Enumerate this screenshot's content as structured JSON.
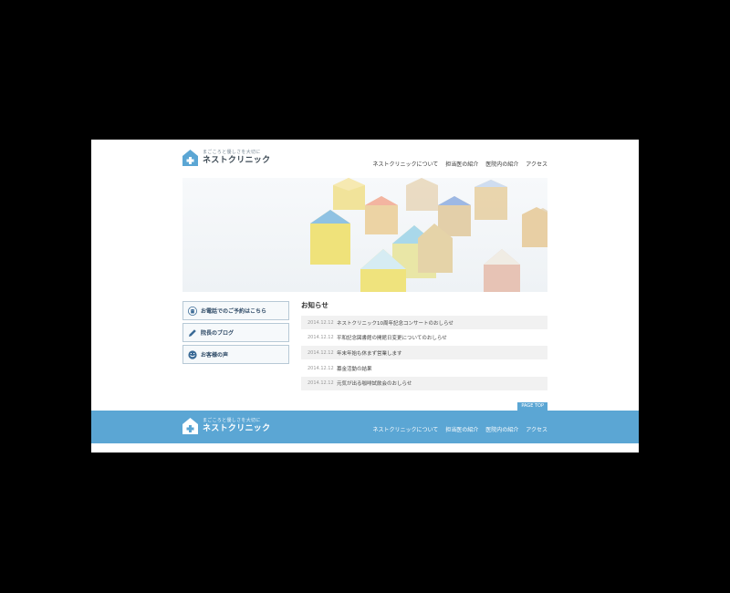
{
  "header": {
    "tagline": "まごころと優しさを大切に",
    "brand": "ネストクリニック",
    "nav": [
      "ネストクリニックについて",
      "担当医の紹介",
      "医院内の紹介",
      "アクセス"
    ]
  },
  "sidebar": {
    "buttons": [
      {
        "label": "お電話でのご予約はこちら",
        "icon": "phone-icon"
      },
      {
        "label": "院長のブログ",
        "icon": "pencil-icon"
      },
      {
        "label": "お客様の声",
        "icon": "smile-icon"
      }
    ]
  },
  "news": {
    "heading": "お知らせ",
    "items": [
      {
        "date": "2014.12.12",
        "title": "ネストクリニック10周年記念コンサートのおしらせ"
      },
      {
        "date": "2014.12.12",
        "title": "平和記念図書館の開館日変更についてのおしらせ"
      },
      {
        "date": "2014.12.12",
        "title": "年末年始も休まず営業します"
      },
      {
        "date": "2014.12.12",
        "title": "募金活動の結果"
      },
      {
        "date": "2014.12.12",
        "title": "元気が出る咖啡試飲会のおしらせ"
      }
    ]
  },
  "pagetop": "PAGE TOP",
  "footer": {
    "tagline": "まごころと優しさを大切に",
    "brand": "ネストクリニック",
    "nav": [
      "ネストクリニックについて",
      "担当医の紹介",
      "医院内の紹介",
      "アクセス"
    ]
  },
  "colors": {
    "accent": "#5ba6d4",
    "frame": "#000000"
  }
}
